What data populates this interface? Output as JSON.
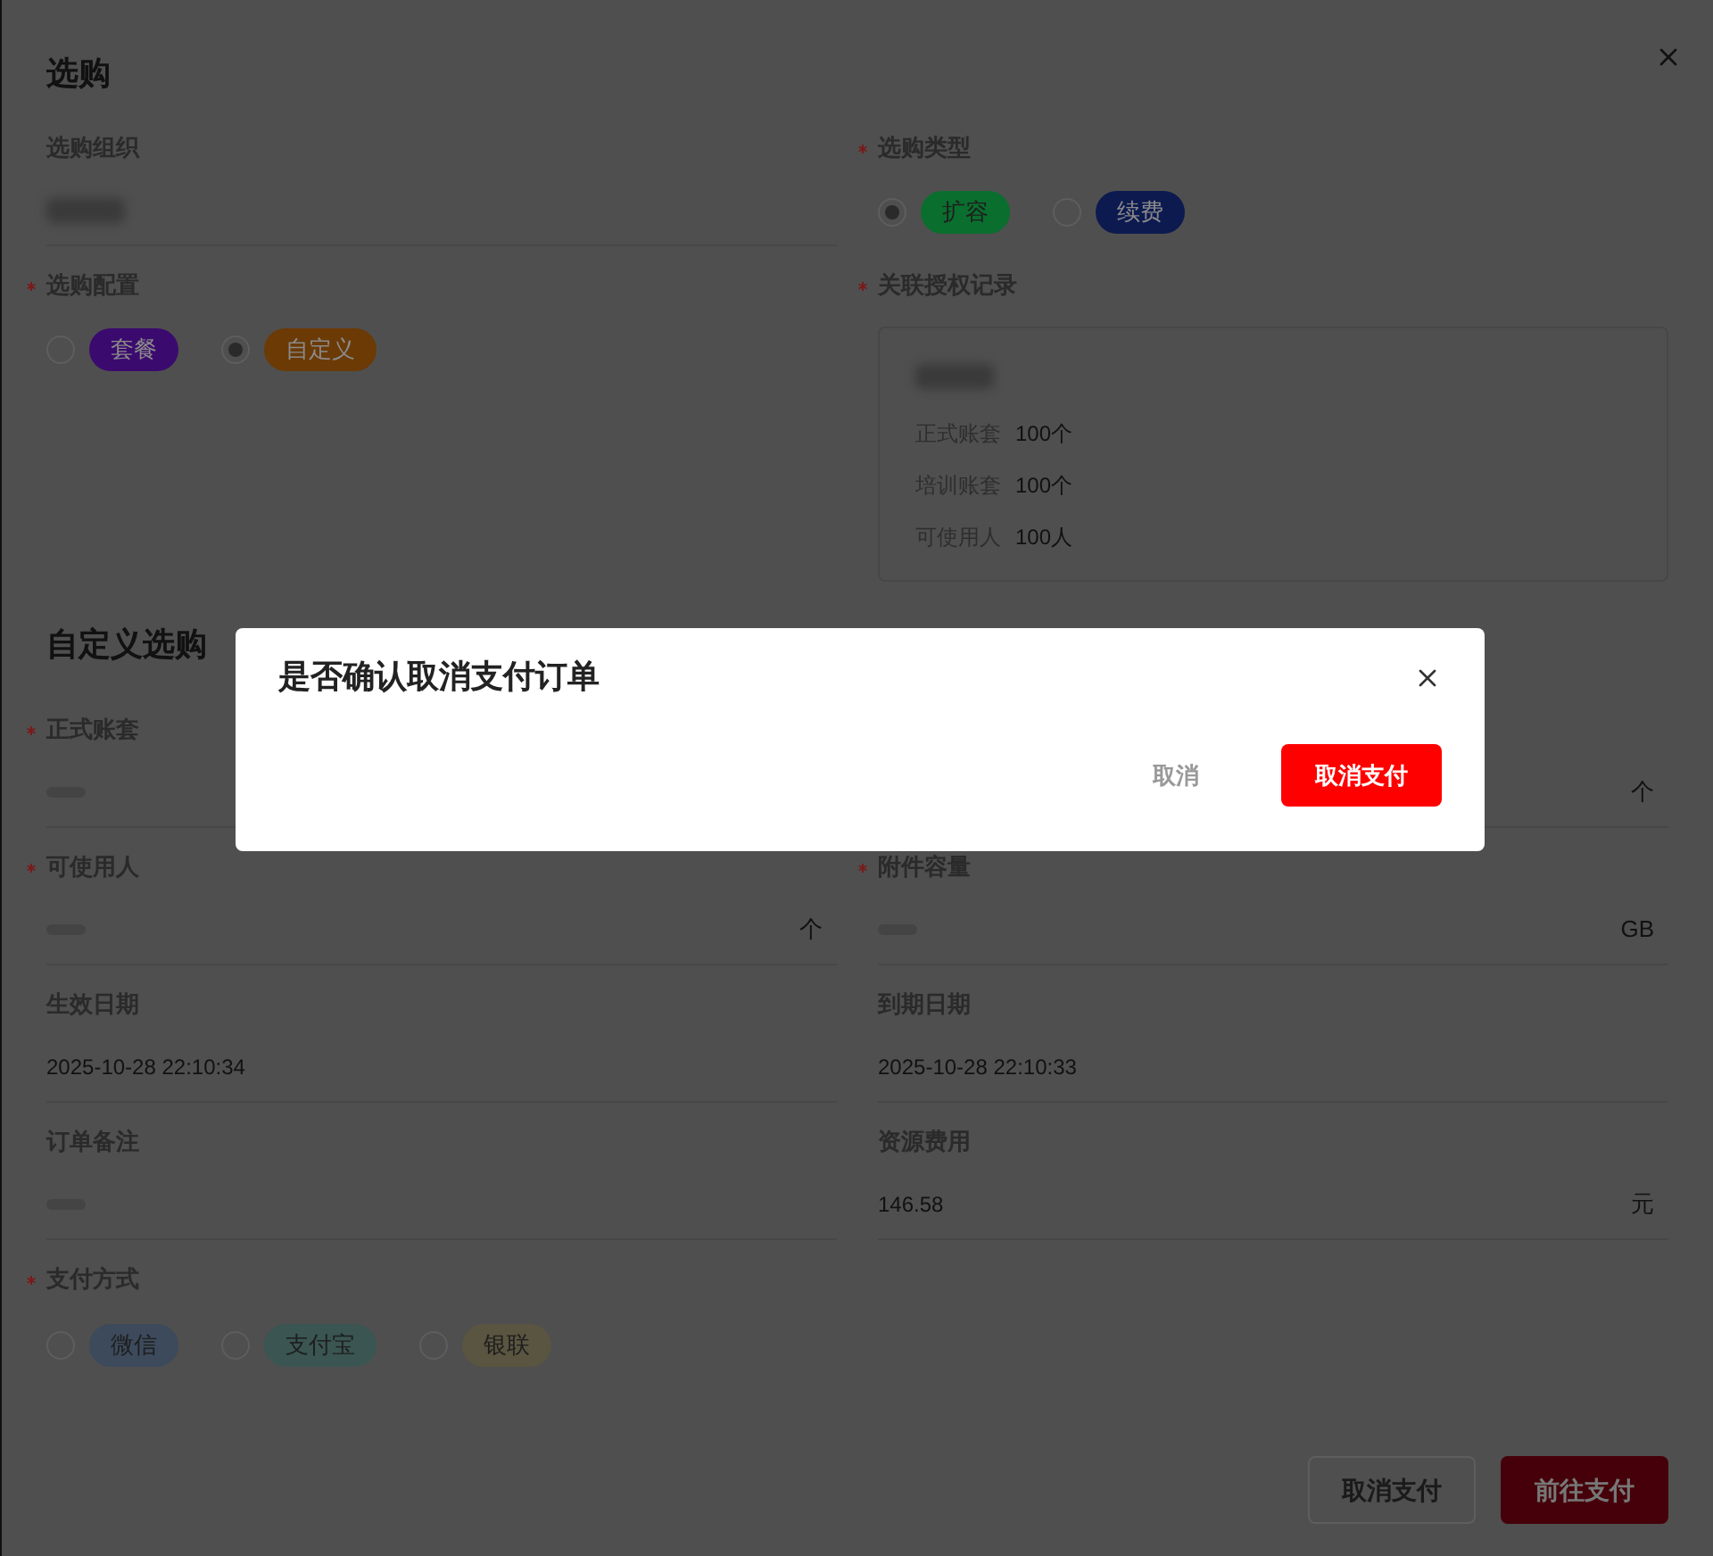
{
  "purchase": {
    "title": "选购",
    "fields": [
      {
        "label": "选购组织",
        "kind": "redacted"
      },
      {
        "label": "选购类型",
        "required": true,
        "kind": "radio",
        "options": [
          {
            "label": "扩容",
            "color": "#0a6e2e",
            "selected": true
          },
          {
            "label": "续费",
            "color": "#0c1a50",
            "selected": false
          }
        ]
      },
      {
        "label": "选购配置",
        "required": true,
        "kind": "radio",
        "options": [
          {
            "label": "套餐",
            "color": "#3b0a6e",
            "selected": false
          },
          {
            "label": "自定义",
            "color": "#6b3a05",
            "selected": true
          }
        ]
      },
      {
        "label": "关联授权记录",
        "required": true,
        "kind": "record",
        "items": [
          {
            "label": "正式账套",
            "value": "100个"
          },
          {
            "label": "培训账套",
            "value": "100个"
          },
          {
            "label": "可使用人",
            "value": "100人"
          }
        ]
      }
    ],
    "section_title": "自定义选购",
    "custom_fields": [
      {
        "label": "正式账套",
        "required": true,
        "kind": "empty"
      },
      {
        "kind": "blank",
        "unit": "个"
      },
      {
        "label": "可使用人",
        "required": true,
        "kind": "empty",
        "unit": "个"
      },
      {
        "label": "附件容量",
        "required": true,
        "kind": "empty",
        "unit": "GB"
      },
      {
        "label": "生效日期",
        "kind": "text",
        "value": "2025-10-28 22:10:34"
      },
      {
        "label": "到期日期",
        "kind": "text",
        "value": "2025-10-28 22:10:33"
      },
      {
        "label": "订单备注",
        "kind": "empty"
      },
      {
        "label": "资源费用",
        "kind": "text",
        "value": "146.58",
        "unit": "元"
      }
    ],
    "payment": {
      "label": "支付方式",
      "required": true,
      "options": [
        {
          "label": "微信",
          "color": "#3c4a5c",
          "selected": false
        },
        {
          "label": "支付宝",
          "color": "#3a5552",
          "selected": false
        },
        {
          "label": "银联",
          "color": "#5a5540",
          "selected": false
        }
      ]
    },
    "buttons": [
      {
        "label": "取消支付",
        "kind": "secondary"
      },
      {
        "label": "前往支付",
        "kind": "primary"
      }
    ]
  },
  "confirm": {
    "title": "是否确认取消支付订单",
    "buttons": [
      {
        "label": "取消",
        "kind": "text"
      },
      {
        "label": "取消支付",
        "kind": "danger"
      }
    ]
  }
}
